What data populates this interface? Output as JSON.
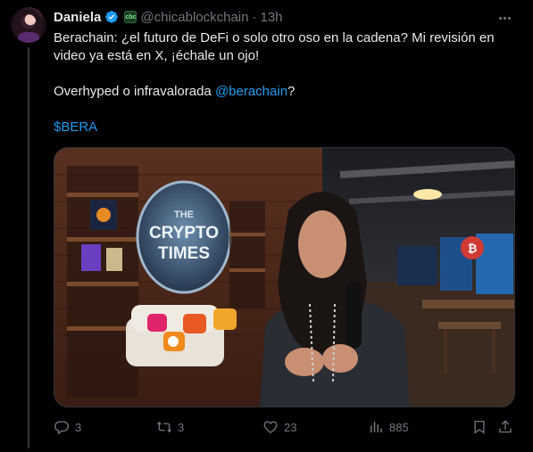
{
  "post": {
    "author_name": "Daniela",
    "handle": "@chicablockchain",
    "separator": "·",
    "time": "13h",
    "affiliate_badge": "cbc",
    "text_line1": "Berachain: ¿el futuro de DeFi o solo otro oso en la cadena? Mi revisión en video ya está en X, ¡échale un ojo!",
    "text_line2_prefix": "Overhyped o infravalorada ",
    "mention": "@berachain",
    "text_line2_suffix": "?",
    "cashtag": "$BERA"
  },
  "media": {
    "sign_line1": "THE",
    "sign_line2": "CRYPTO",
    "sign_line3": "TIMES"
  },
  "actions": {
    "replies": "3",
    "reposts": "3",
    "likes": "23",
    "views": "885"
  },
  "colors": {
    "background": "#000000",
    "text": "#e7e9ea",
    "muted": "#71767b",
    "link": "#1d9bf0",
    "verified": "#1d9bf0"
  },
  "icons": [
    "verified-badge-icon",
    "more-icon",
    "reply-icon",
    "repost-icon",
    "like-icon",
    "views-icon",
    "bookmark-icon",
    "share-icon"
  ]
}
